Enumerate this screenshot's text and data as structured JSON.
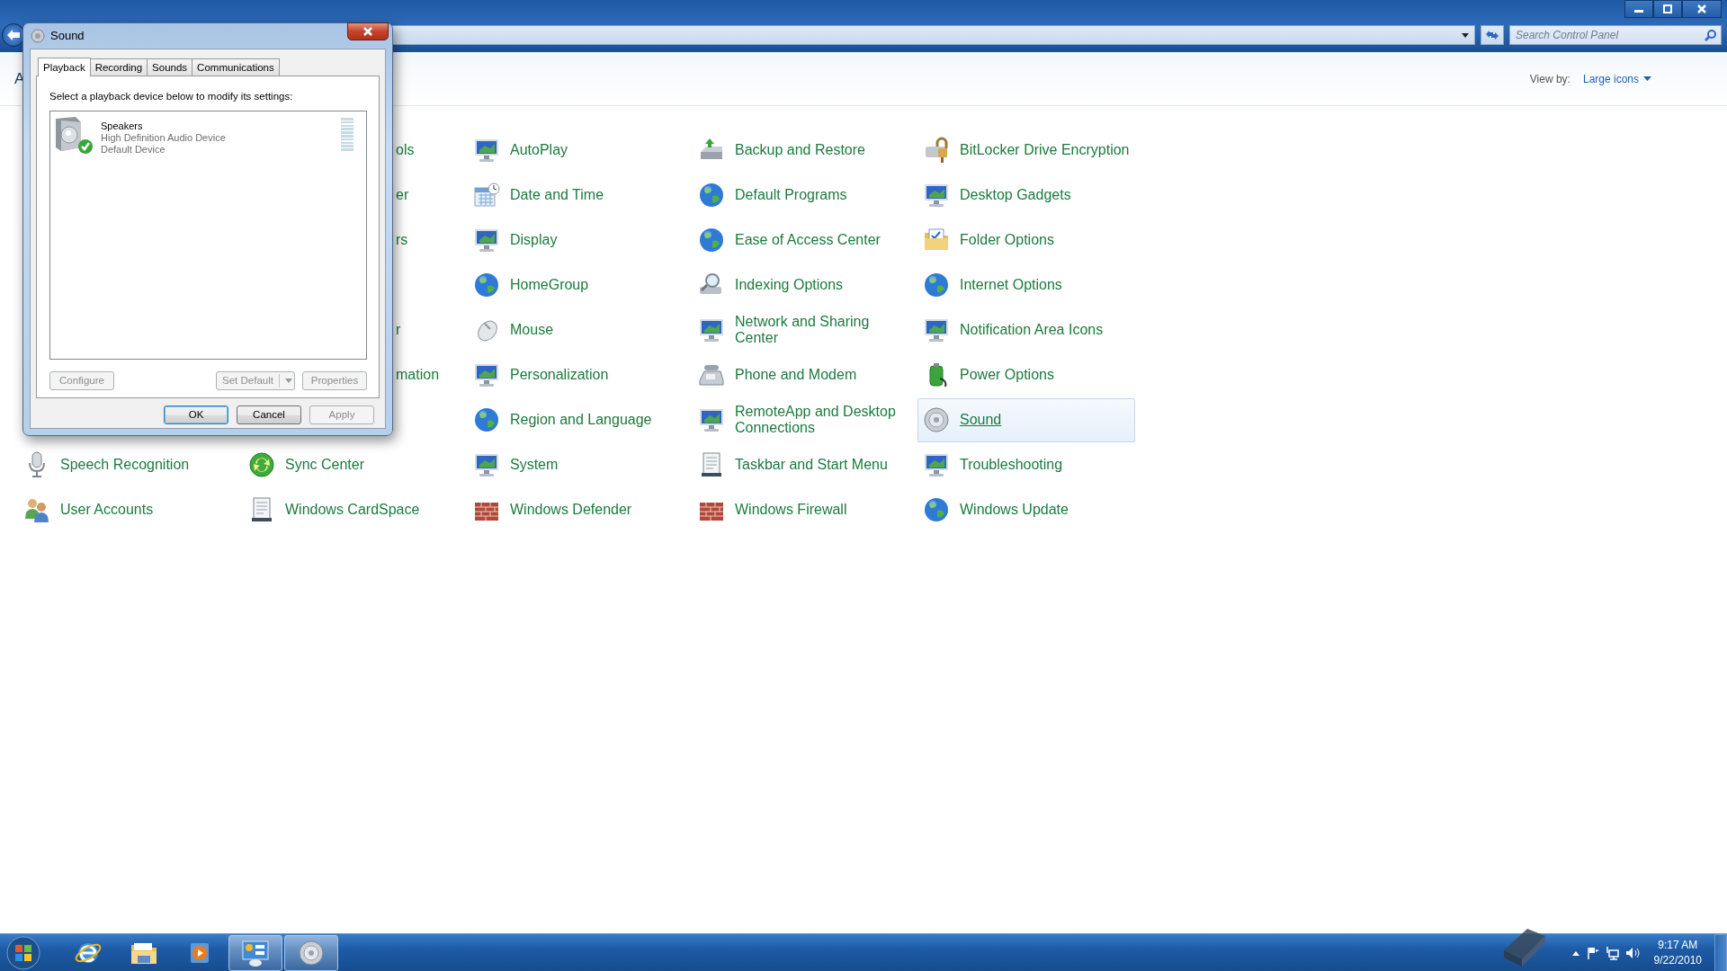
{
  "window": {
    "search": {
      "placeholder": "Search Control Panel"
    },
    "heading_fragment": "A",
    "view_by": {
      "label": "View by:",
      "value": "Large icons"
    }
  },
  "rows": [
    [
      {
        "label": "ols",
        "kind": "cut",
        "selected": false
      },
      {
        "label": "AutoPlay",
        "kind": "full",
        "selected": false
      },
      {
        "label": "Backup and Restore",
        "kind": "full",
        "selected": false
      },
      {
        "label": "BitLocker Drive Encryption",
        "kind": "full",
        "selected": false
      }
    ],
    [
      {
        "label": "er",
        "kind": "cut",
        "selected": false
      },
      {
        "label": "Date and Time",
        "kind": "full",
        "selected": false
      },
      {
        "label": "Default Programs",
        "kind": "full",
        "selected": false
      },
      {
        "label": "Desktop Gadgets",
        "kind": "full",
        "selected": false
      }
    ],
    [
      {
        "label": "rs",
        "kind": "cut",
        "selected": false
      },
      {
        "label": "Display",
        "kind": "full",
        "selected": false
      },
      {
        "label": "Ease of Access Center",
        "kind": "full",
        "selected": false
      },
      {
        "label": "Folder Options",
        "kind": "full",
        "selected": false
      }
    ],
    [
      {
        "label": "HomeGroup",
        "kind": "full",
        "selected": false
      },
      {
        "label": "Indexing Options",
        "kind": "full",
        "selected": false
      },
      {
        "label": "Internet Options",
        "kind": "full",
        "selected": false
      }
    ],
    [
      {
        "label": "r",
        "kind": "cut",
        "selected": false
      },
      {
        "label": "Mouse",
        "kind": "full",
        "selected": false
      },
      {
        "label": "Network and Sharing Center",
        "kind": "full",
        "selected": false
      },
      {
        "label": "Notification Area Icons",
        "kind": "full",
        "selected": false
      }
    ],
    [
      {
        "label": "mation",
        "kind": "cut",
        "selected": false
      },
      {
        "label": "Personalization",
        "kind": "full",
        "selected": false
      },
      {
        "label": "Phone and Modem",
        "kind": "full",
        "selected": false
      },
      {
        "label": "Power Options",
        "kind": "full",
        "selected": false
      }
    ],
    [
      {
        "label": "Region and Language",
        "kind": "full",
        "selected": false
      },
      {
        "label": "RemoteApp and Desktop Connections",
        "kind": "full",
        "selected": false
      },
      {
        "label": "Sound",
        "kind": "full",
        "selected": true
      }
    ],
    [
      {
        "label": "Speech Recognition",
        "kind": "full",
        "selected": false
      },
      {
        "label": "Sync Center",
        "kind": "full",
        "selected": false
      },
      {
        "label": "System",
        "kind": "full",
        "selected": false
      },
      {
        "label": "Taskbar and Start Menu",
        "kind": "full",
        "selected": false
      },
      {
        "label": "Troubleshooting",
        "kind": "full",
        "selected": false
      }
    ],
    [
      {
        "label": "User Accounts",
        "kind": "full",
        "selected": false
      },
      {
        "label": "Windows CardSpace",
        "kind": "full",
        "selected": false
      },
      {
        "label": "Windows Defender",
        "kind": "full",
        "selected": false
      },
      {
        "label": "Windows Firewall",
        "kind": "full",
        "selected": false
      },
      {
        "label": "Windows Update",
        "kind": "full",
        "selected": false
      }
    ]
  ],
  "dialog": {
    "title": "Sound",
    "tabs": [
      {
        "label": "Playback",
        "selected": true
      },
      {
        "label": "Recording",
        "selected": false
      },
      {
        "label": "Sounds",
        "selected": false
      },
      {
        "label": "Communications",
        "selected": false
      }
    ],
    "instruction": "Select a playback device below to modify its settings:",
    "devices": [
      {
        "name": "Speakers",
        "description": "High Definition Audio Device",
        "status": "Default Device",
        "is_default": true,
        "level": 0
      }
    ],
    "device_buttons": [
      {
        "label": "Configure",
        "kind": "plain",
        "disabled": true
      },
      {
        "label": "Set Default",
        "kind": "split",
        "disabled": true
      },
      {
        "label": "Properties",
        "kind": "plain",
        "disabled": true
      }
    ],
    "buttons": [
      {
        "label": "OK",
        "default": true,
        "disabled": false
      },
      {
        "label": "Cancel",
        "default": false,
        "disabled": false
      },
      {
        "label": "Apply",
        "default": false,
        "disabled": true
      }
    ]
  },
  "taskbar": {
    "apps": [
      {
        "kind": "browser",
        "active": false
      },
      {
        "kind": "folder",
        "active": false
      },
      {
        "kind": "media",
        "active": false
      },
      {
        "kind": "control_panel",
        "active": true
      },
      {
        "kind": "speaker",
        "active": true
      }
    ],
    "clock": {
      "time": "9:17 AM",
      "date": "9/22/2010"
    }
  }
}
